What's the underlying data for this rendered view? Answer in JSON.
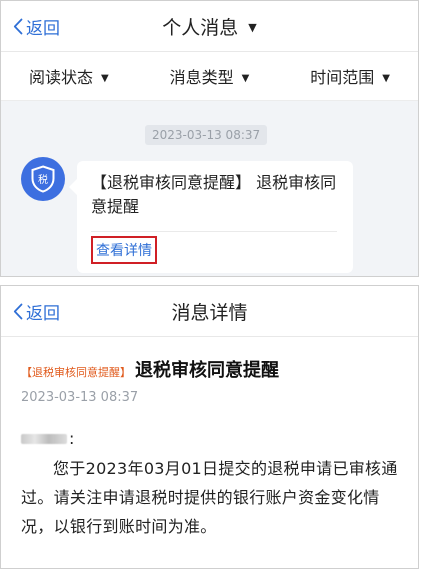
{
  "screen1": {
    "back_label": "返回",
    "title": "个人消息",
    "title_caret": "▼",
    "filters": [
      {
        "label": "阅读状态",
        "caret": "▼"
      },
      {
        "label": "消息类型",
        "caret": "▼"
      },
      {
        "label": "时间范围",
        "caret": "▼"
      }
    ],
    "message": {
      "timestamp": "2023-03-13 08:37",
      "avatar_icon": "tax-shield-icon",
      "avatar_char": "税",
      "text": "【退税审核同意提醒】 退税审核同意提醒",
      "link": "查看详情"
    }
  },
  "screen2": {
    "back_label": "返回",
    "title": "消息详情",
    "tag": "【退税审核同意提醒】",
    "heading": "退税审核同意提醒",
    "date": "2023-03-13 08:37",
    "colon": ":",
    "body": "您于2023年03月01日提交的退税申请已审核通过。请关注申请退税时提供的银行账户资金变化情况，以银行到账时间为准。"
  },
  "colors": {
    "accent": "#2f6fd6",
    "highlight_border": "#d01f25",
    "tag_orange": "#e05a1c",
    "message_bg": "#f2f4f7"
  }
}
